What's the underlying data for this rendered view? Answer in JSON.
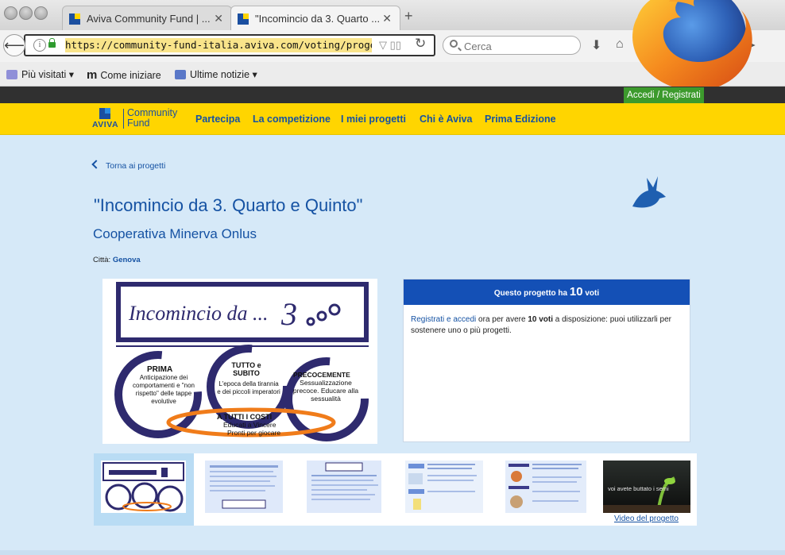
{
  "browser": {
    "tabs": [
      {
        "title": "Aviva Community Fund | ...",
        "active": false
      },
      {
        "title": "\"Incomincio da 3. Quarto ...",
        "active": true
      }
    ],
    "url": "https://community-fund-italia.aviva.com/voting/progetto/scheda",
    "search_placeholder": "Cerca",
    "bookmarks": [
      "Più visitati",
      "Come iniziare",
      "Ultime notizie"
    ]
  },
  "site": {
    "login_label": "Accedi / Registrati",
    "logo": {
      "brand": "AVIVA",
      "line1": "Community",
      "line2": "Fund"
    },
    "menu": [
      "Partecipa",
      "La competizione",
      "I miei progetti",
      "Chi è Aviva",
      "Prima Edizione"
    ],
    "back_label": "Torna ai progetti",
    "project_title": "\"Incomincio da 3. Quarto e Quinto\"",
    "organization": "Cooperativa Minerva Onlus",
    "city_label": "Città:",
    "city": "Genova",
    "votes": {
      "prefix": "Questo progetto ha",
      "count": "10",
      "suffix": "voti",
      "register_link": "Registrati e accedi",
      "body_1": "ora per avere",
      "body_bold": "10 voti",
      "body_2": "a disposizione: puoi utilizzarli per sostenere uno o più progetti."
    },
    "poster": {
      "headline": "Incomincio da ...",
      "digit": "3",
      "circles": [
        {
          "title": "PRIMA",
          "text": "Anticipazione dei comportamenti e \"non rispetto\" delle tappe evolutive"
        },
        {
          "title": "TUTTO e SUBITO",
          "text": "L'epoca della tirannia e dei piccoli imperatori"
        },
        {
          "title": "PRECOCEMENTE",
          "text": "Sessualizzazione precoce. Educare alla sessualità"
        }
      ],
      "banner_title": "A TUTTI I COSTI",
      "banner_line1": "Educati a Vincere",
      "banner_line2": "Pronti per giocare"
    },
    "video_label": "Video del progetto",
    "video_caption": "voi avete buttato i semi"
  },
  "colors": {
    "brand_blue": "#1552a3",
    "aviva_yellow": "#ffd500",
    "vote_blue": "#1450b6",
    "login_green": "#3c9a2c"
  }
}
